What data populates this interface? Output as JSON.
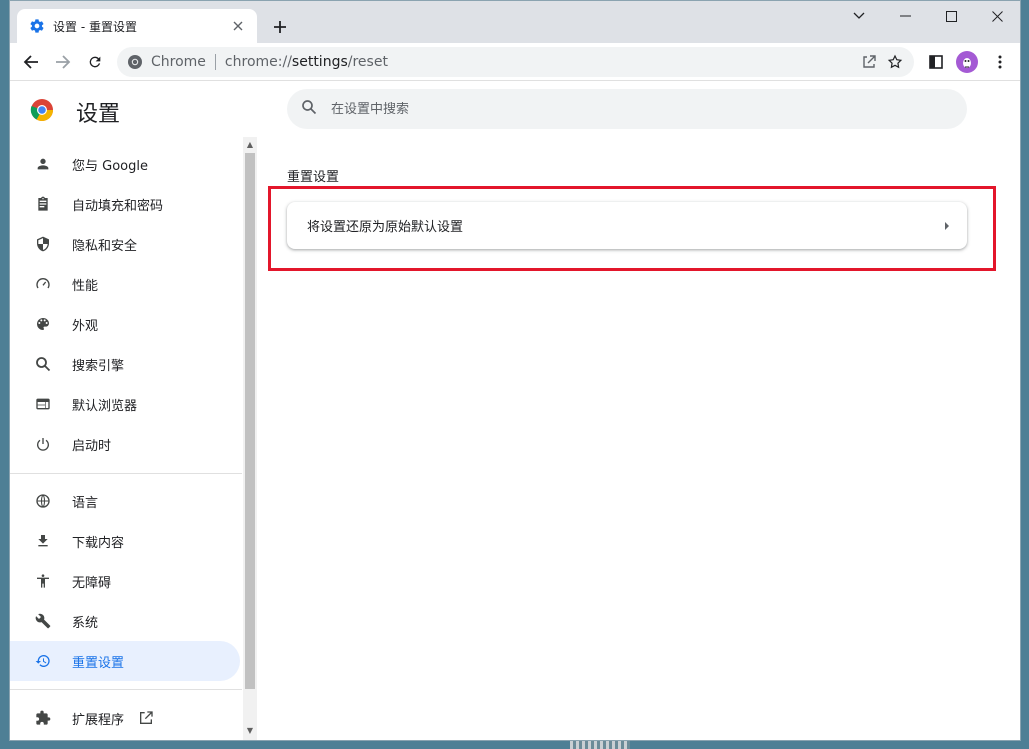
{
  "tab": {
    "title": "设置 - 重置设置"
  },
  "omnibox": {
    "site": "Chrome",
    "url_prefix": "chrome://",
    "url_host": "settings",
    "url_path": "/reset"
  },
  "header": {
    "title": "设置"
  },
  "search": {
    "placeholder": "在设置中搜索"
  },
  "sidebar": {
    "items": [
      {
        "label": "您与 Google",
        "icon": "person-icon"
      },
      {
        "label": "自动填充和密码",
        "icon": "clipboard-icon"
      },
      {
        "label": "隐私和安全",
        "icon": "shield-icon"
      },
      {
        "label": "性能",
        "icon": "speedometer-icon"
      },
      {
        "label": "外观",
        "icon": "palette-icon"
      },
      {
        "label": "搜索引擎",
        "icon": "search-icon"
      },
      {
        "label": "默认浏览器",
        "icon": "browser-icon"
      },
      {
        "label": "启动时",
        "icon": "power-icon"
      },
      {
        "label": "语言",
        "icon": "globe-icon"
      },
      {
        "label": "下载内容",
        "icon": "download-icon"
      },
      {
        "label": "无障碍",
        "icon": "accessibility-icon"
      },
      {
        "label": "系统",
        "icon": "wrench-icon"
      },
      {
        "label": "重置设置",
        "icon": "restore-icon",
        "active": true
      },
      {
        "label": "扩展程序",
        "icon": "puzzle-icon"
      }
    ]
  },
  "main": {
    "section_title": "重置设置",
    "reset_card_label": "将设置还原为原始默认设置"
  },
  "colors": {
    "accent": "#1a73e8",
    "active_bg": "#e8f0fe",
    "highlight": "#e3162b"
  }
}
